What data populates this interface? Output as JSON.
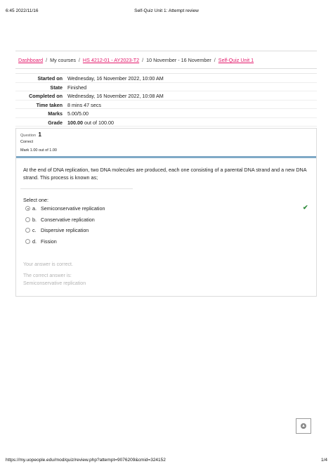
{
  "print_header": {
    "time": "6:45 2022/11/16",
    "title": "Self-Quiz Unit 1: Attempt review"
  },
  "breadcrumb": [
    {
      "label": "Dashboard",
      "link": true
    },
    {
      "label": "My courses",
      "link": false
    },
    {
      "label": "HS 4212-01 - AY2023-T2",
      "link": true
    },
    {
      "label": "10 November - 16 November",
      "link": false
    },
    {
      "label": "Self-Quiz Unit 1",
      "link": true
    }
  ],
  "breadcrumb_separator": "/",
  "summary": [
    {
      "label": "Started on",
      "value": "Wednesday, 16 November 2022, 10:00 AM"
    },
    {
      "label": "State",
      "value": "Finished"
    },
    {
      "label": "Completed on",
      "value": "Wednesday, 16 November 2022, 10:08 AM"
    },
    {
      "label": "Time taken",
      "value": "8 mins 47 secs"
    },
    {
      "label": "Marks",
      "value": "5.00/5.00"
    },
    {
      "label": "Grade",
      "value_bold": "100.00",
      "value_rest": " out of 100.00"
    }
  ],
  "question": {
    "number_label": "Question",
    "number": "1",
    "state": "Correct",
    "grade": "Mark 1.00 out of 1.00",
    "text": "At the end of DNA replication, two DNA molecules are produced, each one consisting of a parental DNA strand and a new DNA strand. This process is known as;",
    "prompt": "Select one:",
    "options": [
      {
        "letter": "a.",
        "text": "Semiconservative replication",
        "selected": true,
        "correct": true
      },
      {
        "letter": "b.",
        "text": "Conservative replication",
        "selected": false,
        "correct": false
      },
      {
        "letter": "c.",
        "text": "Dispersive replication",
        "selected": false,
        "correct": false
      },
      {
        "letter": "d.",
        "text": "Fission",
        "selected": false,
        "correct": false
      }
    ],
    "feedback": {
      "status": "Your answer is correct.",
      "correct_label": "The correct answer is:",
      "correct_answer": "Semiconservative replication"
    }
  },
  "back_to_top_icon": "arrow-up-circle-icon",
  "tick_icon": "check-icon",
  "print_footer": {
    "url": "https://my.uopeople.edu/mod/quiz/review.php?attempt=9076209&cmid=324152",
    "page": "1/4"
  },
  "colors": {
    "link": "#e3196b",
    "correct": "#2e8b3a",
    "question_bar": "#7fa9c6"
  }
}
